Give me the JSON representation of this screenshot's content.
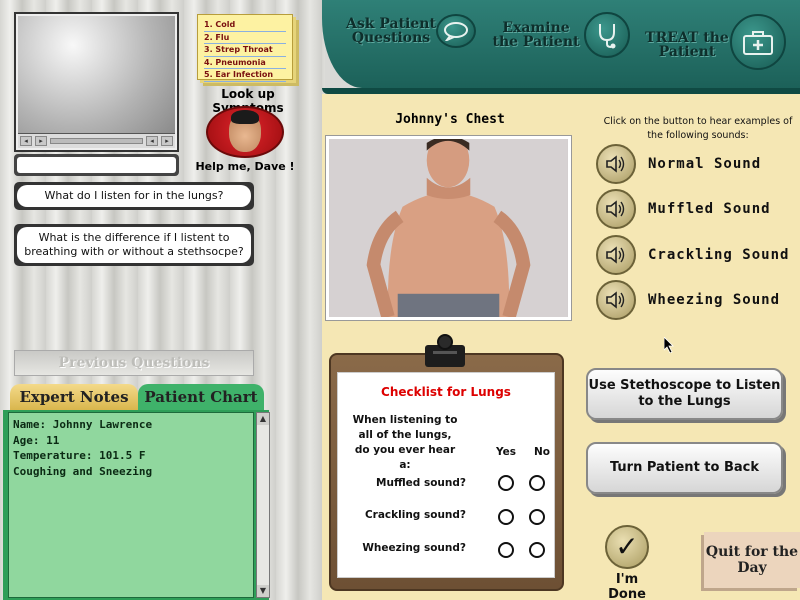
{
  "top_actions": {
    "ask": "Ask Patient Questions",
    "examine": "Examine the Patient",
    "treat": "TREAT the Patient"
  },
  "symptoms": {
    "list": [
      "1. Cold",
      "2. Flu",
      "3. Strep Throat",
      "4. Pneumonia",
      "5. Ear Infection"
    ],
    "lookup_label": "Look up Symptoms"
  },
  "help": {
    "label": "Help me, Dave !"
  },
  "questions": [
    "What do I listen for in the lungs?",
    "What is the difference if I listent to breathing with or without a stethsocpe?"
  ],
  "previous_questions": "Previous Questions",
  "notes": {
    "tab_expert": "Expert Notes",
    "tab_chart": "Patient Chart",
    "lines": [
      "Name: Johnny Lawrence",
      "Age: 11",
      "Temperature: 101.5 F",
      "Coughing and Sneezing"
    ]
  },
  "chest": {
    "title": "Johnny's Chest"
  },
  "sounds": {
    "hint": "Click on the button to hear examples of the following sounds:",
    "items": [
      "Normal Sound",
      "Muffled Sound",
      "Crackling Sound",
      "Wheezing Sound"
    ]
  },
  "checklist": {
    "title": "Checklist for Lungs",
    "question": "When listening to all of the lungs, do you ever hear a:",
    "yes": "Yes",
    "no": "No",
    "items": [
      "Muffled sound?",
      "Crackling sound?",
      "Wheezing sound?"
    ]
  },
  "buttons": {
    "stethoscope": "Use Stethoscope to Listen to the Lungs",
    "turn": "Turn Patient to Back",
    "done": "I'm Done",
    "quit": "Quit for the Day"
  },
  "colors": {
    "teal": "#1c6159",
    "cream": "#f5e7b4",
    "chart_green": "#2e9e58",
    "checklist_red": "#dd0000"
  }
}
